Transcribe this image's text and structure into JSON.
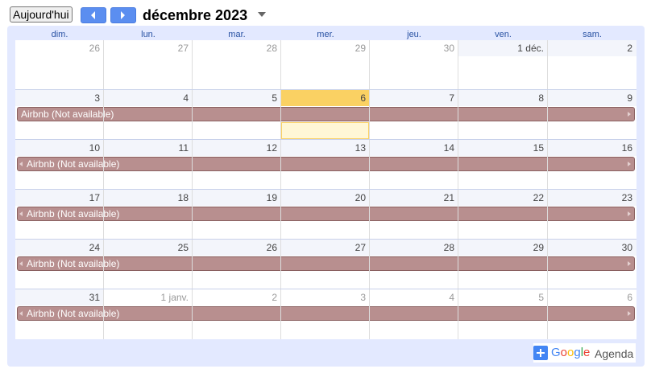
{
  "toolbar": {
    "today_label": "Aujourd'hui",
    "month_title": "décembre 2023"
  },
  "weekdays": [
    "dim.",
    "lun.",
    "mar.",
    "mer.",
    "jeu.",
    "ven.",
    "sam."
  ],
  "weeks": [
    {
      "days": [
        {
          "label": "26",
          "in_month": false
        },
        {
          "label": "27",
          "in_month": false
        },
        {
          "label": "28",
          "in_month": false
        },
        {
          "label": "29",
          "in_month": false
        },
        {
          "label": "30",
          "in_month": false
        },
        {
          "label": "1 déc.",
          "in_month": true
        },
        {
          "label": "2",
          "in_month": true
        }
      ],
      "event": null
    },
    {
      "days": [
        {
          "label": "3",
          "in_month": true
        },
        {
          "label": "4",
          "in_month": true
        },
        {
          "label": "5",
          "in_month": true
        },
        {
          "label": "6",
          "in_month": true,
          "today": true
        },
        {
          "label": "7",
          "in_month": true
        },
        {
          "label": "8",
          "in_month": true
        },
        {
          "label": "9",
          "in_month": true
        }
      ],
      "event": {
        "title": "Airbnb (Not available)",
        "continues_before": false,
        "continues_after": true
      }
    },
    {
      "days": [
        {
          "label": "10",
          "in_month": true
        },
        {
          "label": "11",
          "in_month": true
        },
        {
          "label": "12",
          "in_month": true
        },
        {
          "label": "13",
          "in_month": true
        },
        {
          "label": "14",
          "in_month": true
        },
        {
          "label": "15",
          "in_month": true
        },
        {
          "label": "16",
          "in_month": true
        }
      ],
      "event": {
        "title": "Airbnb (Not available)",
        "continues_before": true,
        "continues_after": true
      }
    },
    {
      "days": [
        {
          "label": "17",
          "in_month": true
        },
        {
          "label": "18",
          "in_month": true
        },
        {
          "label": "19",
          "in_month": true
        },
        {
          "label": "20",
          "in_month": true
        },
        {
          "label": "21",
          "in_month": true
        },
        {
          "label": "22",
          "in_month": true
        },
        {
          "label": "23",
          "in_month": true
        }
      ],
      "event": {
        "title": "Airbnb (Not available)",
        "continues_before": true,
        "continues_after": true
      }
    },
    {
      "days": [
        {
          "label": "24",
          "in_month": true
        },
        {
          "label": "25",
          "in_month": true
        },
        {
          "label": "26",
          "in_month": true
        },
        {
          "label": "27",
          "in_month": true
        },
        {
          "label": "28",
          "in_month": true
        },
        {
          "label": "29",
          "in_month": true
        },
        {
          "label": "30",
          "in_month": true
        }
      ],
      "event": {
        "title": "Airbnb (Not available)",
        "continues_before": true,
        "continues_after": true
      }
    },
    {
      "days": [
        {
          "label": "31",
          "in_month": true
        },
        {
          "label": "1 janv.",
          "in_month": false
        },
        {
          "label": "2",
          "in_month": false
        },
        {
          "label": "3",
          "in_month": false
        },
        {
          "label": "4",
          "in_month": false
        },
        {
          "label": "5",
          "in_month": false
        },
        {
          "label": "6",
          "in_month": false
        }
      ],
      "event": {
        "title": "Airbnb (Not available)",
        "continues_before": true,
        "continues_after": true
      }
    }
  ],
  "badge": {
    "google_word": "Google",
    "agenda_word": "Agenda"
  },
  "colors": {
    "weekday_text": "#2952a3",
    "frame_bg": "#e3e9ff",
    "today_header": "#fad163",
    "today_cell": "#fff7d6",
    "in_month_header_bg": "#f3f5fb",
    "event_bg": "#b88f8f",
    "day_text_in_month": "#444444",
    "day_text_out_month": "#999999",
    "google_blue": "#4285f4",
    "google_red": "#ea4335",
    "google_yellow": "#fbbc05",
    "google_green": "#34a853"
  }
}
